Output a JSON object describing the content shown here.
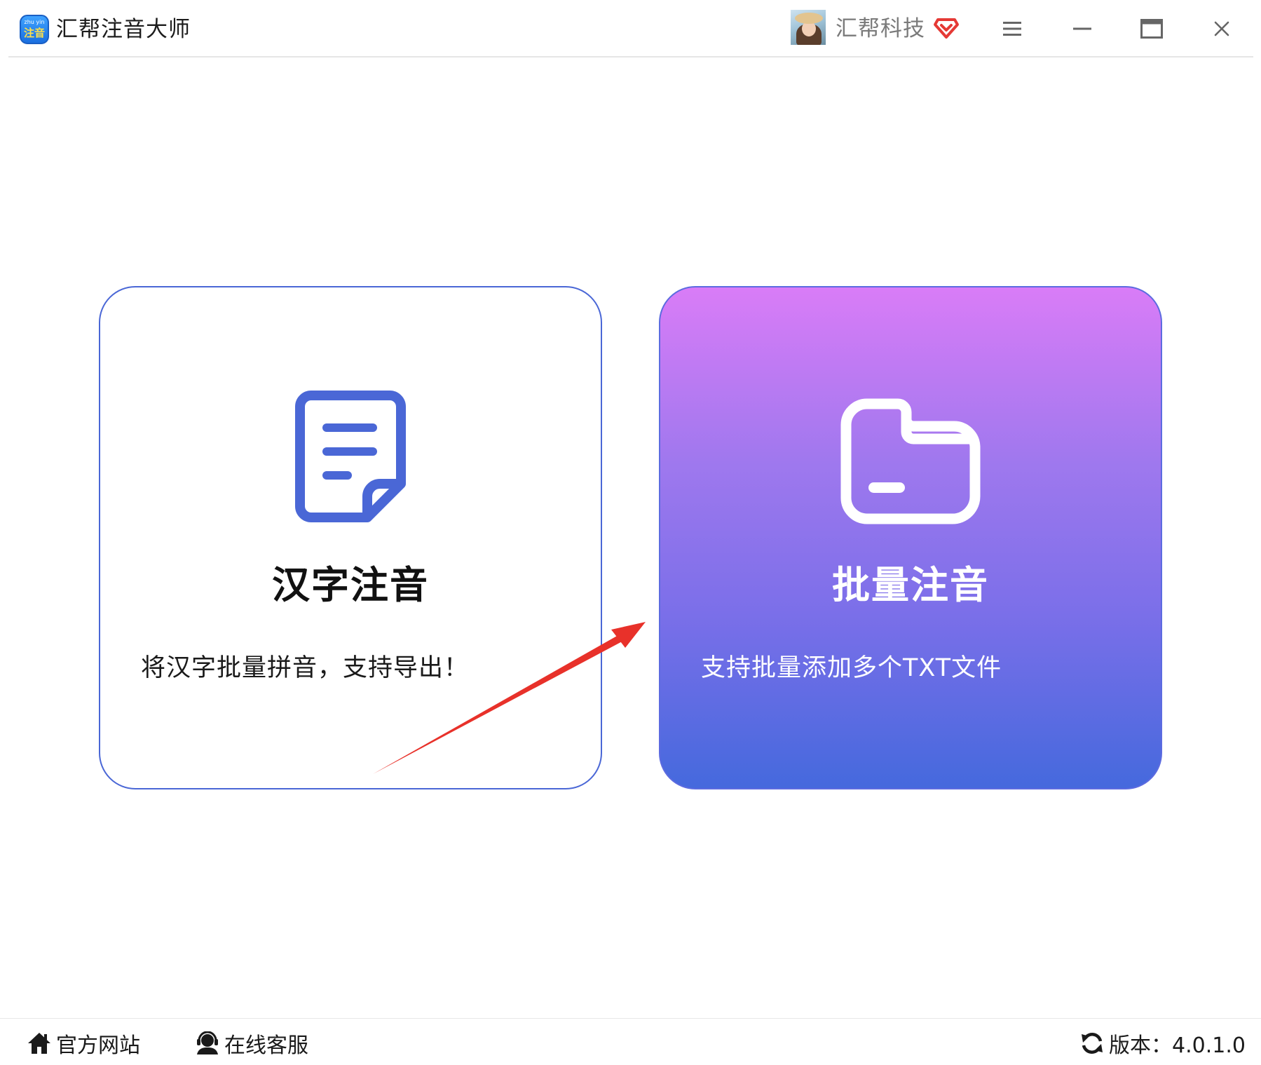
{
  "app": {
    "title": "汇帮注音大师",
    "logo_top": "zhu yin",
    "logo_bottom": "注音"
  },
  "header": {
    "company": "汇帮科技",
    "icons": {
      "avatar": "user-avatar",
      "vip": "vip-diamond-icon",
      "menu": "hamburger-menu-icon",
      "minimize": "minimize-icon",
      "maximize": "maximize-icon",
      "close": "close-icon"
    }
  },
  "cards": [
    {
      "id": "single",
      "title": "汉字注音",
      "description": "将汉字批量拼音，支持导出！",
      "icon": "document-icon"
    },
    {
      "id": "batch",
      "title": "批量注音",
      "description": "支持批量添加多个TXT文件",
      "icon": "folder-icon"
    }
  ],
  "footer": {
    "website": "官方网站",
    "support": "在线客服",
    "version": "版本：4.0.1.0"
  },
  "colors": {
    "accent_blue": "#4a67d6",
    "gradient_top": "#d97cf7",
    "gradient_bottom": "#4569dd",
    "annotation_arrow": "#e8312a",
    "vip_red": "#e53935"
  }
}
